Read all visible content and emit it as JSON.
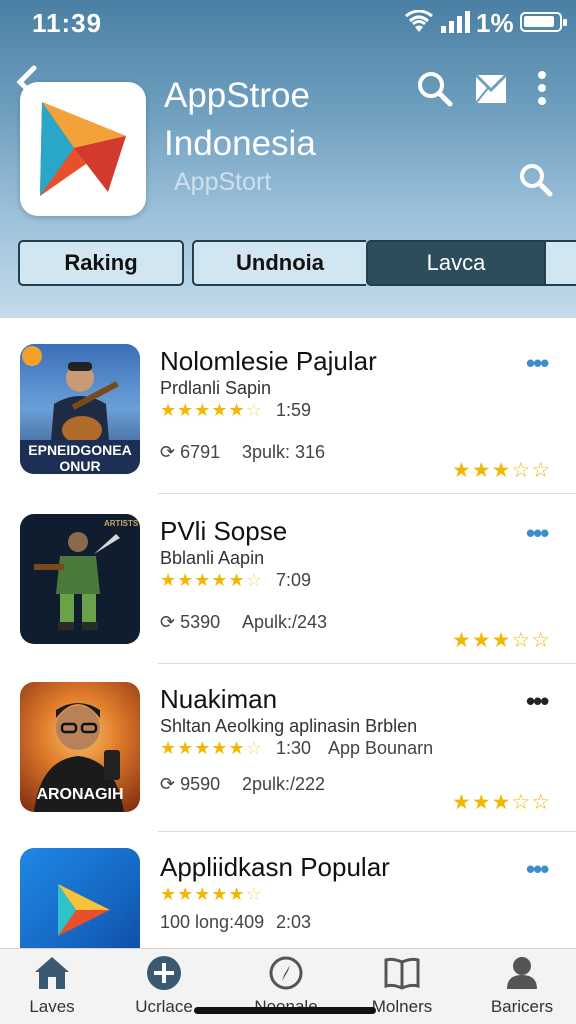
{
  "status": {
    "time": "11:39",
    "battery": "1%"
  },
  "header": {
    "title": "AppStroe Indonesia",
    "subtitle": "AppStort",
    "icons": [
      "back-icon",
      "search-icon",
      "mail-icon",
      "more-vertical-icon",
      "search-icon"
    ]
  },
  "tabs": [
    {
      "label": "Raking",
      "active": false
    },
    {
      "label": "Undnoia",
      "active": false
    },
    {
      "label": "Lavca",
      "active": true
    }
  ],
  "apps": [
    {
      "name": "Nolomlesie Pajular",
      "developer": "Prdlanli Sapin",
      "rating_value": "1:59",
      "stat_a": "6791",
      "stat_b": "3pulk: 316",
      "thumb_text": "EPNEIDGONEA ONUR",
      "stars": 4.5,
      "right_stars": 3.5
    },
    {
      "name": "PVli Sopse",
      "developer": "Bblanli Aapin",
      "rating_value": "7:09",
      "stat_a": "5390",
      "stat_b": "Apulk:/243",
      "thumb_text": "",
      "stars": 4.5,
      "right_stars": 3.5
    },
    {
      "name": "Nuakiman",
      "developer": "Shltan Aeolking aplinasin Brblen",
      "rating_value": "1:30",
      "extra": "App Bounarn",
      "stat_a": "9590",
      "stat_b": "2pulk:/222",
      "thumb_text": "ARONAGIH",
      "stars": 4.5,
      "right_stars": 3.5
    },
    {
      "name": "Appliidkasn Popular",
      "developer": "",
      "rating_value": "2:03",
      "extra": "100 long:409",
      "stars": 4.5
    }
  ],
  "tabbar": [
    {
      "label": "Laves",
      "icon": "home-icon"
    },
    {
      "label": "Ucrlace",
      "icon": "plus-circle-icon"
    },
    {
      "label": "Noonale",
      "icon": "compass-icon"
    },
    {
      "label": "Molners",
      "icon": "book-icon"
    },
    {
      "label": "Baricers",
      "icon": "person-icon"
    }
  ],
  "colors": {
    "header_top": "#4a7fa3",
    "active_tab": "#2d4d5d",
    "star": "#f2b705",
    "dots": "#3a8fc9"
  }
}
